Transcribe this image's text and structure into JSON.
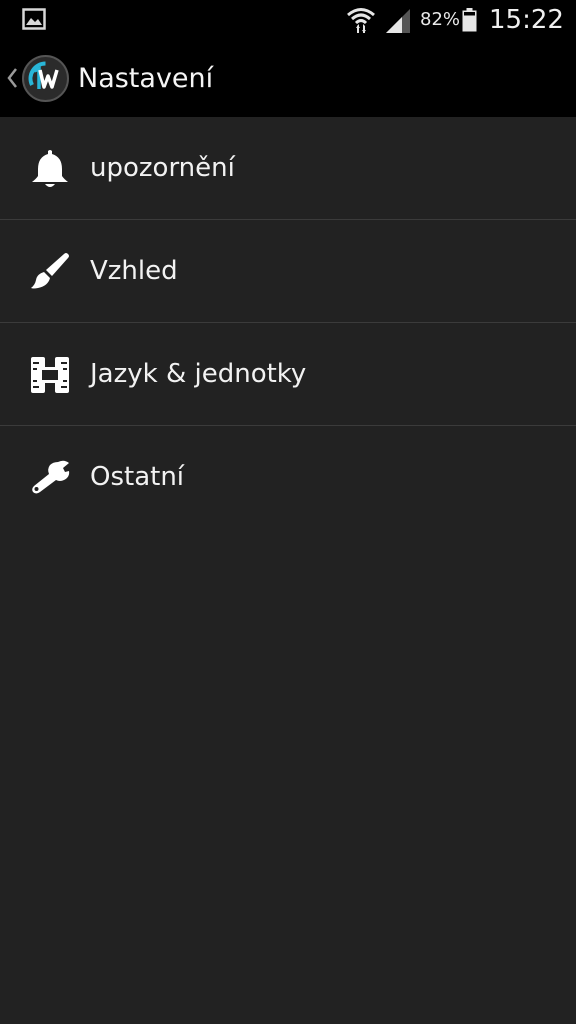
{
  "status_bar": {
    "battery_percent": "82%",
    "time": "15:22",
    "icons": [
      "gallery-icon",
      "wifi-icon",
      "signal-icon",
      "battery-icon"
    ]
  },
  "action_bar": {
    "title": "Nastavení",
    "logo_icon": "app-logo-1w",
    "back_icon": "chevron-left-icon"
  },
  "settings": {
    "items": [
      {
        "label": "upozornění",
        "icon": "bell-icon"
      },
      {
        "label": "Vzhled",
        "icon": "brush-icon"
      },
      {
        "label": "Jazyk & jednotky",
        "icon": "units-icon"
      },
      {
        "label": "Ostatní",
        "icon": "wrench-icon"
      }
    ]
  },
  "colors": {
    "background": "#222222",
    "bar": "#000000",
    "divider": "#3b3b3b",
    "text": "#f2f2f2",
    "logo_accent": "#29b6d8"
  }
}
